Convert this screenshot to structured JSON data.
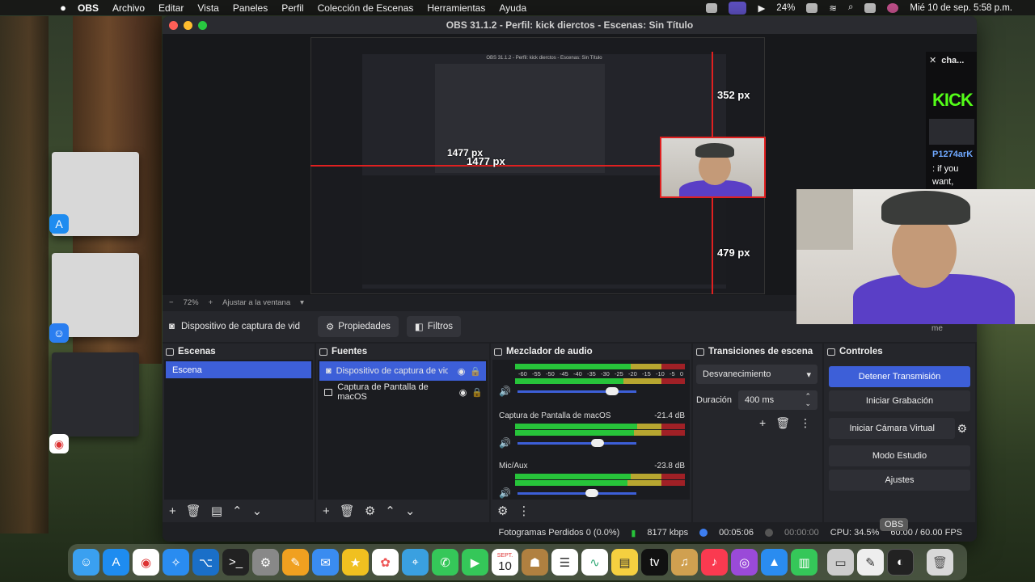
{
  "menubar": {
    "app": "OBS",
    "items": [
      "Archivo",
      "Editar",
      "Vista",
      "Paneles",
      "Perfil",
      "Colección de Escenas",
      "Herramientas",
      "Ayuda"
    ],
    "battery": "24%",
    "datetime": "Mié 10 de sep.  5:58 p.m."
  },
  "window": {
    "title": "OBS 31.1.2 - Perfil: kick dierctos - Escenas: Sin Título"
  },
  "preview": {
    "measure_h": "1477 px",
    "measure_top": "352 px",
    "measure_bottom": "479 px",
    "nested_title": "OBS 31.1.2 - Perfil: kick dierctos - Escenas: Sin Título",
    "nested_measure": "1477 px",
    "chat": {
      "header": "cha...",
      "kick_logo": "KICK",
      "user": "P1274arK",
      "message": ": if you want, here's the invite",
      "tail": "me"
    }
  },
  "zoom": {
    "minus": "−",
    "value": "72%",
    "plus": "+",
    "fit": "Ajustar a la ventana"
  },
  "toolbar": {
    "source_name": "Dispositivo de captura de vid",
    "properties": "Propiedades",
    "filters": "Filtros"
  },
  "scenes": {
    "title": "Escenas",
    "items": [
      "Escena"
    ]
  },
  "sources": {
    "title": "Fuentes",
    "items": [
      "Dispositivo de captura de video",
      "Captura de Pantalla de macOS"
    ]
  },
  "mixer": {
    "title": "Mezclador de audio",
    "ticks": [
      "-60",
      "-55",
      "-50",
      "-45",
      "-40",
      "-35",
      "-30",
      "-25",
      "-20",
      "-15",
      "-10",
      "-5",
      "0"
    ],
    "channels": [
      {
        "name": "",
        "db": ""
      },
      {
        "name": "Captura de Pantalla de macOS",
        "db": "-21.4 dB"
      },
      {
        "name": "Mic/Aux",
        "db": "-23.8 dB"
      }
    ]
  },
  "transitions": {
    "title": "Transiciones de escena",
    "selected": "Desvanecimiento",
    "duration_label": "Duración",
    "duration_value": "400 ms"
  },
  "controls": {
    "title": "Controles",
    "stop_stream": "Detener Transmisión",
    "start_recording": "Iniciar Grabación",
    "start_virtual_cam": "Iniciar Cámara Virtual",
    "studio_mode": "Modo Estudio",
    "settings": "Ajustes"
  },
  "status": {
    "dropped": "Fotogramas Perdidos 0 (0.0%)",
    "bitrate": "8177 kbps",
    "stream_time": "00:05:06",
    "rec_time": "00:00:00",
    "cpu": "CPU: 34.5%",
    "fps": "60.00 / 60.00 FPS"
  },
  "dock": {
    "tooltip": "OBS",
    "calendar_month": "SEPT.",
    "calendar_day": "10"
  },
  "colors": {
    "accent": "#3d5fd8",
    "kick": "#53fc18",
    "measure": "#e02020"
  }
}
